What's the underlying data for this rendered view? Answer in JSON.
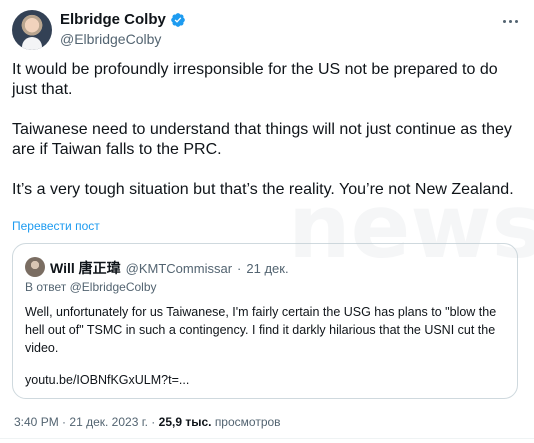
{
  "author": {
    "name": "Elbridge Colby",
    "handle": "@ElbridgeColby",
    "verified_color": "#1d9bf0"
  },
  "tweet": {
    "paragraphs": [
      "It would be profoundly irresponsible for the US not be prepared to do just that.",
      "Taiwanese need to understand that things will not just continue as they are if Taiwan falls to the PRC.",
      "It’s a very tough situation but that’s the reality. You’re not New Zealand."
    ],
    "translate_label": "Перевести пост"
  },
  "quote": {
    "name": "Will 唐正瑋",
    "handle": "@KMTCommissar",
    "separator": "·",
    "date": "21 дек.",
    "reply_prefix": "В ответ",
    "reply_mention": "@ElbridgeColby",
    "body": "Well, unfortunately for us Taiwanese, I'm fairly certain the USG has plans to \"blow the hell out of\" TSMC in such a contingency. I find it darkly hilarious that the USNI cut the video.",
    "link": "youtu.be/IOBNfKGxULM?t=..."
  },
  "meta": {
    "time": "3:40 PM",
    "dot": "·",
    "date": "21 дек. 2023 г.",
    "views_count": "25,9 тыс.",
    "views_label": "просмотров"
  },
  "watermark": "news"
}
